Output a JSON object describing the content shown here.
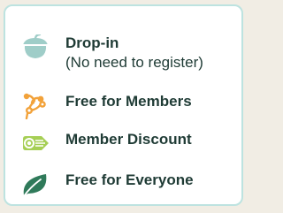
{
  "legend": {
    "items": [
      {
        "icon": "acorn-icon",
        "label": "Drop-in",
        "note": "(No need to register)"
      },
      {
        "icon": "flower-bloom-icon",
        "label": "Free for Members"
      },
      {
        "icon": "discount-tag-icon",
        "label": "Member Discount"
      },
      {
        "icon": "leaf-icon",
        "label": "Free for Everyone"
      }
    ]
  },
  "colors": {
    "page_background": "#f1ede4",
    "card_border": "#bde3e0",
    "text": "#1f3b35",
    "acorn": "#9fcdc8",
    "flower": "#f2a23a",
    "discount_tag": "#a6cf55",
    "leaf": "#2f7a5a"
  }
}
